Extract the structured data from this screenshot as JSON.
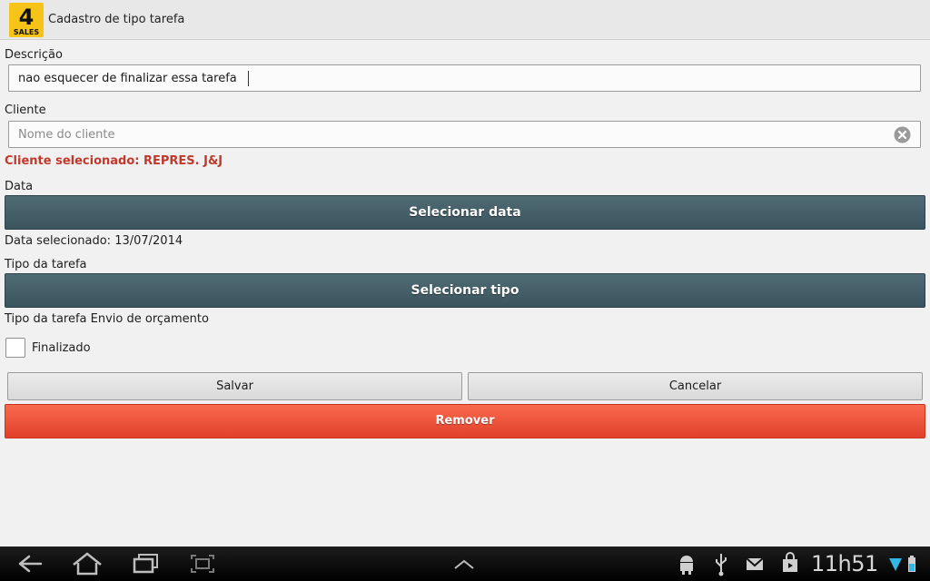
{
  "app": {
    "title": "Cadastro de tipo tarefa",
    "logo_text": "4 SALES"
  },
  "form": {
    "descricao_label": "Descrição",
    "descricao_value": "nao esquecer de finalizar essa tarefa",
    "cliente_label": "Cliente",
    "cliente_placeholder": "Nome do cliente",
    "cliente_selected": "Cliente selecionado: REPRES. J&J",
    "data_label": "Data",
    "select_date_button": "Selecionar data",
    "data_selected": "Data selecionado: 13/07/2014",
    "tipo_label": "Tipo da tarefa",
    "select_type_button": "Selecionar tipo",
    "tipo_selected": "Tipo da tarefa Envio de orçamento",
    "finalizado_label": "Finalizado",
    "finalizado_checked": false
  },
  "actions": {
    "save": "Salvar",
    "cancel": "Cancelar",
    "remove": "Remover"
  },
  "colors": {
    "accent_dark_button": "#45606a",
    "remove_button": "#ee5438",
    "client_selected_text": "#c0392b",
    "logo_yellow": "#f6c419"
  },
  "system_bar": {
    "time": "11h51",
    "icons": [
      "back-icon",
      "home-icon",
      "recent-apps-icon",
      "screenshot-icon",
      "up-chevron-icon",
      "android-debug-icon",
      "usb-icon",
      "gmail-icon",
      "shop-bag-icon",
      "wifi-icon",
      "battery-icon"
    ]
  }
}
